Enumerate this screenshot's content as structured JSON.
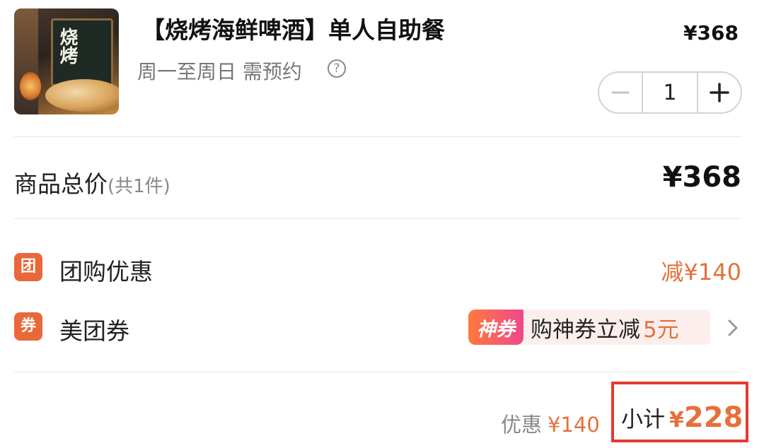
{
  "product": {
    "title": "【烧烤海鲜啤酒】单人自助餐",
    "subtitle": "周一至周日 需预约",
    "help_glyph": "?",
    "thumbnail_text": "烧烤",
    "unit_price": "¥368",
    "quantity": "1",
    "minus_glyph": "−",
    "plus_glyph": "+"
  },
  "summary": {
    "total_label": "商品总价",
    "total_count": "(共1件)",
    "total_value": "¥368"
  },
  "discounts": {
    "group_icon": "团",
    "group_label": "团购优惠",
    "group_value": "减¥140",
    "coupon_icon": "券",
    "coupon_label": "美团券",
    "coupon_badge": "神券",
    "coupon_text": "购神券立减",
    "coupon_amount": "5元"
  },
  "footer": {
    "saved_label": "优惠",
    "saved_value": "¥140",
    "subtotal_label": "小计",
    "subtotal_currency": "¥",
    "subtotal_value": "228"
  },
  "colors": {
    "accent": "#e5703b",
    "highlight_border": "#e53a2f",
    "tag_bg": "#e9683a"
  }
}
